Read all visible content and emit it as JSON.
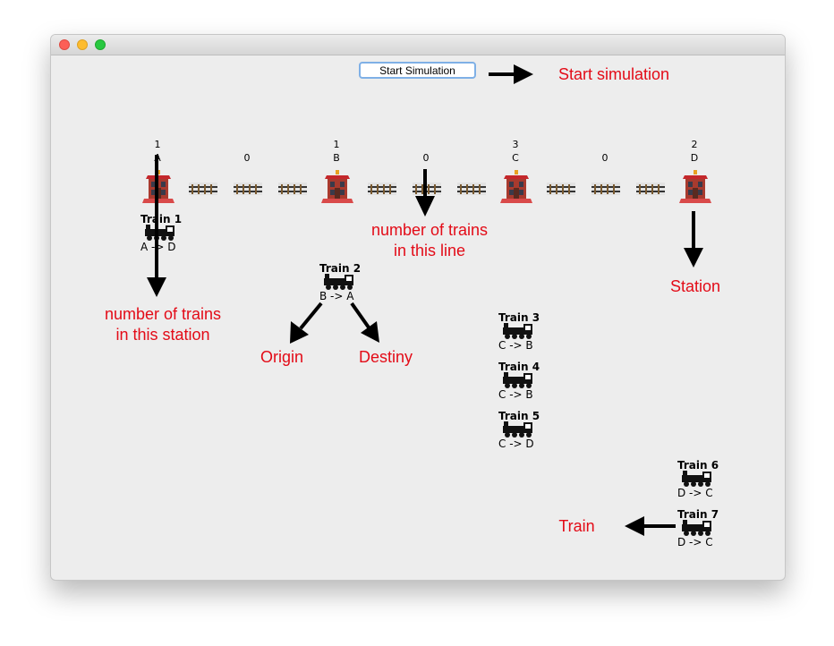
{
  "window": {
    "buttons": [
      "close",
      "minimize",
      "zoom"
    ]
  },
  "toolbar": {
    "start_label": "Start Simulation"
  },
  "stations": [
    {
      "name": "A",
      "count": "1"
    },
    {
      "name": "B",
      "count": "1"
    },
    {
      "name": "C",
      "count": "3"
    },
    {
      "name": "D",
      "count": "2"
    }
  ],
  "lines": [
    {
      "count": "0"
    },
    {
      "count": "0"
    },
    {
      "count": "0"
    }
  ],
  "trains": [
    {
      "name": "Train 1",
      "route": "A -> D"
    },
    {
      "name": "Train 2",
      "route": "B -> A"
    },
    {
      "name": "Train 3",
      "route": "C -> B"
    },
    {
      "name": "Train 4",
      "route": "C -> B"
    },
    {
      "name": "Train 5",
      "route": "C -> D"
    },
    {
      "name": "Train 6",
      "route": "D -> C"
    },
    {
      "name": "Train 7",
      "route": "D -> C"
    }
  ],
  "annotations": {
    "start_simulation": "Start simulation",
    "trains_in_line_1": "number of trains",
    "trains_in_line_2": "in this line",
    "station": "Station",
    "trains_in_station_1": "number of trains",
    "trains_in_station_2": "in this station",
    "origin": "Origin",
    "destiny": "Destiny",
    "train": "Train"
  },
  "colors": {
    "annotation": "#e30b17",
    "button_focus": "#7fb0e6",
    "background": "#ededed"
  }
}
